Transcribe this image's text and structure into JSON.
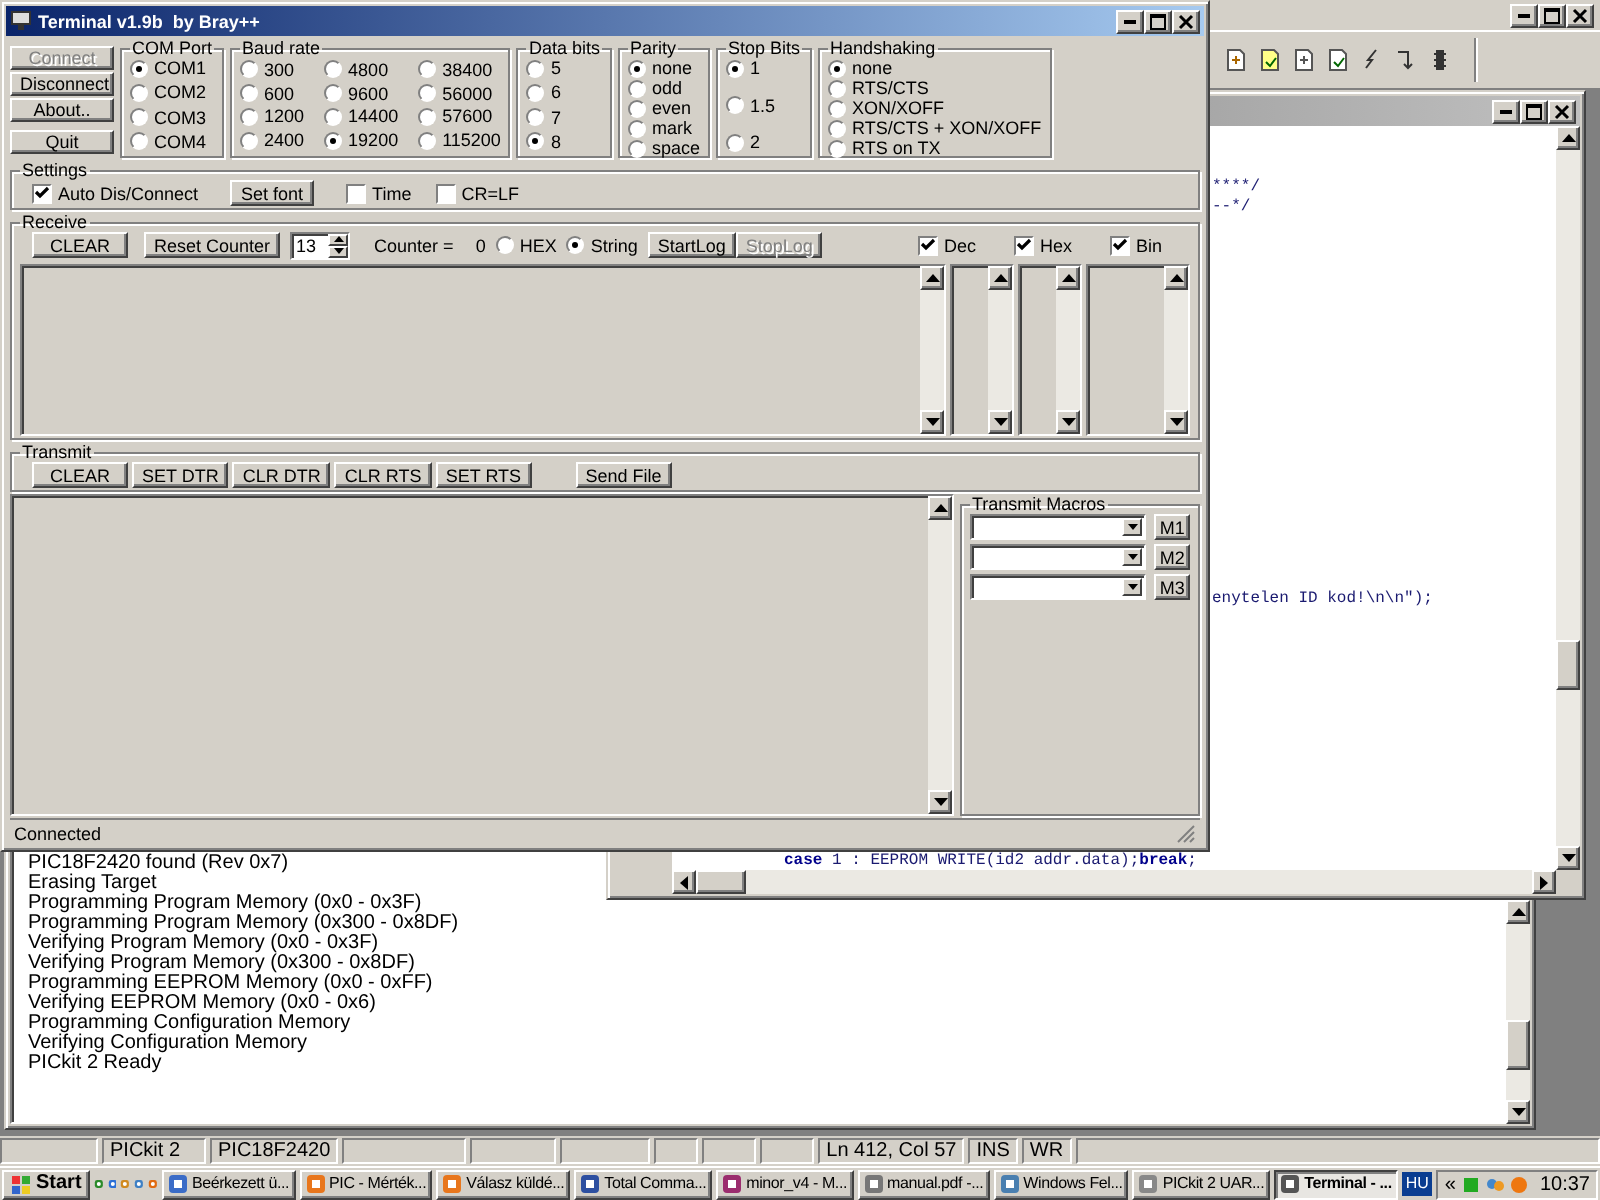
{
  "terminal": {
    "title": "Terminal v1.9b  by Bray++",
    "commands": [
      {
        "label": "Connect",
        "disabled": true
      },
      {
        "label": "Disconnect",
        "disabled": false
      },
      {
        "label": "About..",
        "disabled": false
      },
      {
        "label": "Quit",
        "disabled": false
      }
    ],
    "groups": [
      {
        "title": "COM Port",
        "kind": "list",
        "options": [
          {
            "label": "COM1",
            "selected": true
          },
          {
            "label": "COM2",
            "selected": false
          },
          {
            "label": "COM3",
            "selected": false
          },
          {
            "label": "COM4",
            "selected": false
          }
        ]
      },
      {
        "title": "Baud rate",
        "kind": "columns",
        "options": [
          {
            "label": "300",
            "selected": false
          },
          {
            "label": "600",
            "selected": false
          },
          {
            "label": "1200",
            "selected": false
          },
          {
            "label": "2400",
            "selected": false
          },
          {
            "label": "4800",
            "selected": false
          },
          {
            "label": "9600",
            "selected": false
          },
          {
            "label": "14400",
            "selected": false
          },
          {
            "label": "19200",
            "selected": true
          },
          {
            "label": "38400",
            "selected": false
          },
          {
            "label": "56000",
            "selected": false
          },
          {
            "label": "57600",
            "selected": false
          },
          {
            "label": "115200",
            "selected": false
          }
        ]
      },
      {
        "title": "Data bits",
        "kind": "list",
        "options": [
          {
            "label": "5",
            "selected": false
          },
          {
            "label": "6",
            "selected": false
          },
          {
            "label": "7",
            "selected": false
          },
          {
            "label": "8",
            "selected": true
          }
        ]
      },
      {
        "title": "Parity",
        "kind": "list",
        "options": [
          {
            "label": "none",
            "selected": true
          },
          {
            "label": "odd",
            "selected": false
          },
          {
            "label": "even",
            "selected": false
          },
          {
            "label": "mark",
            "selected": false
          },
          {
            "label": "space",
            "selected": false
          }
        ]
      },
      {
        "title": "Stop Bits",
        "kind": "list",
        "options": [
          {
            "label": "1",
            "selected": true
          },
          {
            "label": "1.5",
            "selected": false
          },
          {
            "label": "2",
            "selected": false
          }
        ]
      },
      {
        "title": "Handshaking",
        "kind": "list",
        "options": [
          {
            "label": "none",
            "selected": true
          },
          {
            "label": "RTS/CTS",
            "selected": false
          },
          {
            "label": "XON/XOFF",
            "selected": false
          },
          {
            "label": "RTS/CTS + XON/XOFF",
            "selected": false
          },
          {
            "label": "RTS on TX",
            "selected": false
          }
        ]
      }
    ],
    "settings": {
      "title": "Settings",
      "items": [
        {
          "kind": "checkbox",
          "label": "Auto Dis/Connect",
          "checked": true
        },
        {
          "kind": "button",
          "label": "Set font"
        },
        {
          "kind": "checkbox",
          "label": "Time",
          "checked": false
        },
        {
          "kind": "checkbox",
          "label": "CR=LF",
          "checked": false
        }
      ]
    },
    "receive": {
      "title": "Receive",
      "clear": "CLEAR",
      "reset": "Reset Counter",
      "spin_value": "13",
      "counter_label": "Counter =",
      "counter_value": "0",
      "modes": [
        {
          "label": "HEX",
          "selected": false
        },
        {
          "label": "String",
          "selected": true
        }
      ],
      "log_buttons": [
        {
          "label": "StartLog",
          "disabled": false
        },
        {
          "label": "StopLog",
          "disabled": true
        }
      ],
      "views": [
        {
          "label": "Dec",
          "checked": true
        },
        {
          "label": "Hex",
          "checked": true
        },
        {
          "label": "Bin",
          "checked": true
        }
      ]
    },
    "transmit": {
      "title": "Transmit",
      "buttons": [
        "CLEAR",
        "SET DTR",
        "CLR DTR",
        "CLR RTS",
        "SET RTS",
        "Send File"
      ]
    },
    "macros": {
      "title": "Transmit Macros",
      "buttons": [
        "M1",
        "M2",
        "M3"
      ]
    },
    "status": "Connected"
  },
  "editor": {
    "lines": [
      {
        "kind": "tail",
        "text": "****/"
      },
      {
        "kind": "tail",
        "text": "--*/"
      },
      {
        "kind": "tail",
        "text": "enytelen ID kod!\\n\\n\");"
      },
      {
        "kind": "code",
        "text": "**case** 1 : EEPROM WRITE(id2 addr.data);**break**;"
      }
    ]
  },
  "output": {
    "lines": [
      "PIC18F2420 found (Rev 0x7)",
      "Erasing Target",
      "Programming Program Memory (0x0 - 0x3F)",
      "Programming Program Memory (0x300 - 0x8DF)",
      "Verifying Program Memory (0x0 - 0x3F)",
      "Verifying Program Memory (0x300 - 0x8DF)",
      "Programming EEPROM Memory (0x0 - 0xFF)",
      "Verifying EEPROM Memory (0x0 - 0x6)",
      "Programming Configuration Memory",
      "Verifying Configuration Memory",
      "PICkit 2 Ready"
    ]
  },
  "status_bar": [
    "PICkit 2",
    "PIC18F2420",
    "Ln 412, Col 57",
    "INS",
    "WR"
  ],
  "taskbar": {
    "start": "Start",
    "tasks": [
      {
        "label": "Beérkezett ü...",
        "selected": false
      },
      {
        "label": "PIC - Mérték...",
        "selected": false
      },
      {
        "label": "Válasz küldé...",
        "selected": false
      },
      {
        "label": "Total Comma...",
        "selected": false
      },
      {
        "label": "minor_v4 - M...",
        "selected": false
      },
      {
        "label": "manual.pdf -...",
        "selected": false
      },
      {
        "label": "Windows Fel...",
        "selected": false
      },
      {
        "label": "PICkit 2 UAR...",
        "selected": false
      },
      {
        "label": "Terminal - ...",
        "selected": true
      }
    ],
    "language": "HU",
    "tray_toggle": "«",
    "clock": "10:37"
  }
}
